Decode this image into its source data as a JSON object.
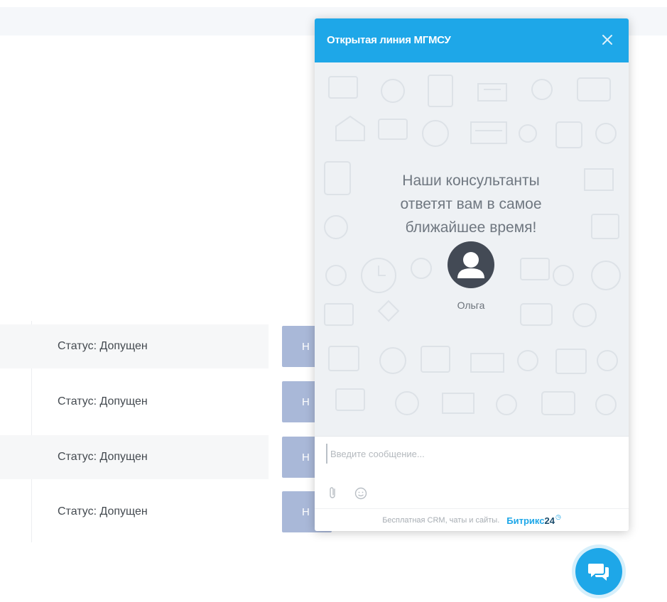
{
  "chat": {
    "title": "Открытая линия МГМСУ",
    "welcome_line1": "Наши консультанты",
    "welcome_line2": "ответят вам в самое",
    "welcome_line3": "ближайшее время!",
    "agent_name": "Ольга",
    "input_placeholder": "Введите сообщение...",
    "footer_text": "Бесплатная CRM, чаты и сайты.",
    "brand_name": "Битрикс",
    "brand_number": "24",
    "accent_color": "#1ea7e8",
    "icons": [
      "close-icon",
      "user-avatar-icon",
      "paperclip-icon",
      "smiley-icon",
      "chat-bubbles-icon"
    ]
  },
  "list": {
    "rows": [
      {
        "status": "Статус: Допущен",
        "button_label": "Н"
      },
      {
        "status": "Статус: Допущен",
        "button_label": "Н"
      },
      {
        "status": "Статус: Допущен",
        "button_label": "Н"
      },
      {
        "status": "Статус: Допущен",
        "button_label": "Н"
      }
    ]
  }
}
